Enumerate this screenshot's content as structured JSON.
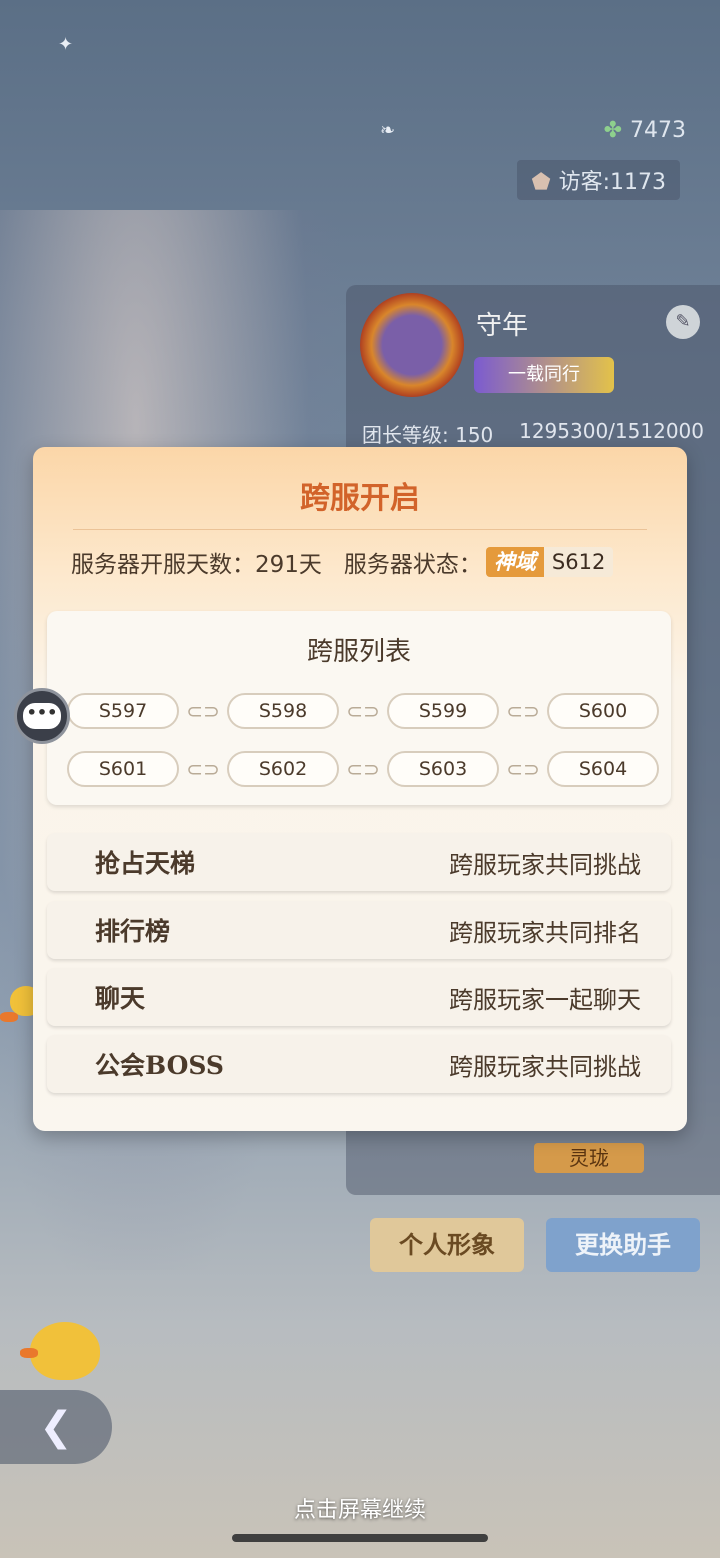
{
  "top_stats": {
    "clover_icon": "clover-icon",
    "clover_count": "7473",
    "visitor_icon": "location-pin-icon",
    "visitor_text": "访客:1173"
  },
  "profile": {
    "name": "守年",
    "title_badge": "一载同行",
    "level_label": "团长等级: 150",
    "exp": "1295300/1512000",
    "assistant_name": "灵珑",
    "personal_button": "个人形象",
    "change_button": "更换助手"
  },
  "dialog": {
    "title": "跨服开启",
    "open_days_label": "服务器开服天数：",
    "open_days_value": "291天",
    "status_label": "服务器状态：",
    "status_realm": "神域",
    "status_server": "S612",
    "list_title": "跨服列表",
    "server_rows": [
      [
        "S597",
        "S598",
        "S599",
        "S600"
      ],
      [
        "S601",
        "S602",
        "S603",
        "S604"
      ]
    ],
    "features": [
      {
        "name": "抢占天梯",
        "desc": "跨服玩家共同挑战"
      },
      {
        "name": "排行榜",
        "desc": "跨服玩家共同排名"
      },
      {
        "name": "聊天",
        "desc": "跨服玩家一起聊天"
      },
      {
        "name": "公会BOSS",
        "desc": "跨服玩家共同挑战"
      }
    ]
  },
  "chat_bubble_text": "•••",
  "continue_text": "点击屏幕继续",
  "colors": {
    "title_orange": "#d2632a",
    "text_brown": "#4b3a2b",
    "realm_badge": "#e59a3b"
  }
}
